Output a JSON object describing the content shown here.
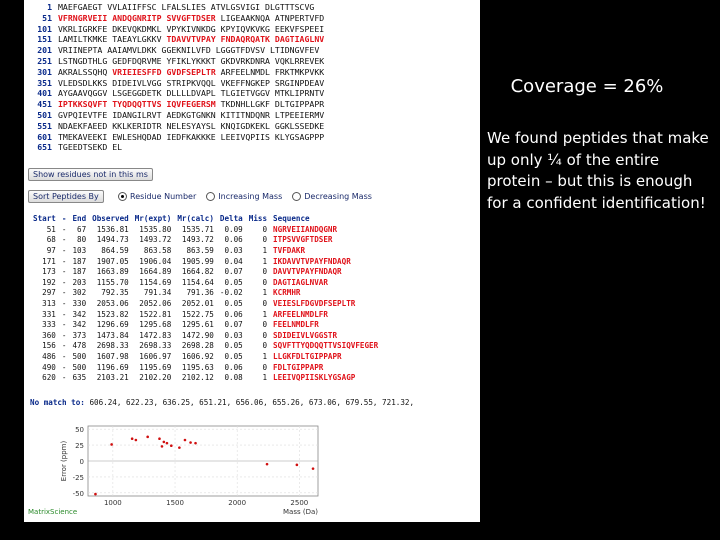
{
  "seq_rows": [
    {
      "num": "1",
      "segs": [
        [
          "MAEFGAEGT VVLAIIFFSC LFALSLIES ATVLGSVIGI DLGTTTSCVG",
          false
        ]
      ]
    },
    {
      "num": "51",
      "segs": [
        [
          "VFRNGRVEII ANDQGNRITP SVVGFTDSER",
          true
        ],
        [
          " LIGEAAKNQA ATNPERTVFD",
          false
        ]
      ]
    },
    {
      "num": "101",
      "segs": [
        [
          "VKRLIGRKFE DKEVQKDMKL VPYKIVNKDG KPYIQVKVKG EEKVFSPEEI",
          false
        ]
      ]
    },
    {
      "num": "151",
      "segs": [
        [
          "LAMILTKMKE TAEAYLGKKV ",
          false
        ],
        [
          "TDAVVTVPAY FNDAQRQATK DAGTIAGLNV",
          true
        ]
      ]
    },
    {
      "num": "201",
      "segs": [
        [
          "VRIINEPTA AAIAMVLDKK GGEKNILVFD LGGGTFDVSV LTIDNGVFEV",
          false
        ]
      ]
    },
    {
      "num": "251",
      "segs": [
        [
          "LSTNGDTHLG GEDFDQRVME YFIKLYKKKT GKDVRKDNRA VQKLRREVEK",
          false
        ]
      ]
    },
    {
      "num": "301",
      "segs": [
        [
          "AKRALSSQHQ ",
          false
        ],
        [
          "VRIEIESFFD GVDFSEPLTR",
          true
        ],
        [
          " ARFEELNMDL FRKTMKPVKK",
          false
        ]
      ]
    },
    {
      "num": "351",
      "segs": [
        [
          "VLEDSDLKKS DIDEIVLVGG STRIPKVQQL VKEFFNGKEP SRGINPDEAV",
          false
        ]
      ]
    },
    {
      "num": "401",
      "segs": [
        [
          "AYGAAVQGGV LSGEGGDETK DLLLLDVAPL TLGIETVGGV MTKLIPRNTV",
          false
        ]
      ]
    },
    {
      "num": "451",
      "segs": [
        [
          "IPTKKSQVFT TYQDQQTTVS IQVFEGERSM",
          true
        ],
        [
          " TKDNHLLGKF DLTGIPPAPR",
          false
        ]
      ]
    },
    {
      "num": "501",
      "segs": [
        [
          "GVPQIEVTFE IDANGILRVT AEDKGTGNKN KITITNDQNR LTPEEIERMV",
          false
        ]
      ]
    },
    {
      "num": "551",
      "segs": [
        [
          "NDAEKFAEED KKLKERIDTR NELESYAYSL KNQIGDKEKL GGKLSSEDKE",
          false
        ]
      ]
    },
    {
      "num": "601",
      "segs": [
        [
          "TMEKAVEEKI EWLESHQDAD IEDFKAKKKE LEEIVQPIIS KLYGSAGPPP",
          false
        ]
      ]
    },
    {
      "num": "651",
      "segs": [
        [
          "TGEEDTSEKD EL",
          false
        ]
      ]
    }
  ],
  "controls": {
    "show_residues_label": "Show residues not in this ms",
    "sort_peptides_label": "Sort Peptides By",
    "sort_options": [
      "Residue Number",
      "Increasing Mass",
      "Decreasing Mass"
    ],
    "sort_selected": 0
  },
  "table": {
    "headers": [
      "Start",
      "-",
      "End",
      "Observed",
      "Mr(expt)",
      "Mr(calc)",
      "Delta",
      "Miss",
      "Sequence"
    ],
    "rows": [
      [
        "51",
        "-",
        "67",
        "1536.81",
        "1535.80",
        "1535.71",
        "0.09",
        "0",
        "NGRVEIIANDQGNR"
      ],
      [
        "68",
        "-",
        "80",
        "1494.73",
        "1493.72",
        "1493.72",
        "0.06",
        "0",
        "ITPSVVGFTDSER"
      ],
      [
        "97",
        "-",
        "103",
        "864.59",
        "863.58",
        "863.59",
        "0.03",
        "1",
        "TVFDAKR"
      ],
      [
        "171",
        "-",
        "187",
        "1907.05",
        "1906.04",
        "1905.99",
        "0.04",
        "1",
        "IKDAVVTVPAYFNDAQR"
      ],
      [
        "173",
        "-",
        "187",
        "1663.89",
        "1664.89",
        "1664.82",
        "0.07",
        "0",
        "DAVVTVPAYFNDAQR"
      ],
      [
        "192",
        "-",
        "203",
        "1155.70",
        "1154.69",
        "1154.64",
        "0.05",
        "0",
        "DAGTIAGLNVAR"
      ],
      [
        "297",
        "-",
        "302",
        "792.35",
        "791.34",
        "791.36",
        "-0.02",
        "1",
        "KCRMHR"
      ],
      [
        "313",
        "-",
        "330",
        "2053.06",
        "2052.06",
        "2052.01",
        "0.05",
        "0",
        "VEIESLFDGVDFSEPLTR"
      ],
      [
        "331",
        "-",
        "342",
        "1523.82",
        "1522.81",
        "1522.75",
        "0.06",
        "1",
        "ARFEELNMDLFR"
      ],
      [
        "333",
        "-",
        "342",
        "1296.69",
        "1295.68",
        "1295.61",
        "0.07",
        "0",
        "FEELNMDLFR"
      ],
      [
        "360",
        "-",
        "373",
        "1473.84",
        "1472.83",
        "1472.90",
        "0.03",
        "0",
        "SDIDEIVLVGGSTR"
      ],
      [
        "156",
        "-",
        "478",
        "2698.33",
        "2698.33",
        "2698.28",
        "0.05",
        "0",
        "SQVFTTYQDQQTTVSIQVFEGER"
      ],
      [
        "486",
        "-",
        "500",
        "1607.98",
        "1606.97",
        "1606.92",
        "0.05",
        "1",
        "LLGKFDLTGIPPAPR"
      ],
      [
        "490",
        "-",
        "500",
        "1196.69",
        "1195.69",
        "1195.63",
        "0.06",
        "0",
        "FDLTGIPPAPR"
      ],
      [
        "620",
        "-",
        "635",
        "2103.21",
        "2102.20",
        "2102.12",
        "0.08",
        "1",
        "LEEIVQPIISKLYGSAGP"
      ]
    ]
  },
  "no_match": {
    "label": "No match to:",
    "values": "606.24, 622.23, 636.25, 651.21, 656.06, 655.26, 673.06, 679.55, 721.32,"
  },
  "error_plot": {
    "ylabel": "Error (ppm)",
    "xlabel": "Mass (Da)",
    "y_ticks": [
      "50",
      "25",
      "0",
      "-25",
      "-50"
    ],
    "x_ticks": [
      "1000",
      "1500",
      "2000",
      "2500"
    ],
    "xlim": [
      800,
      2650
    ],
    "ylim": [
      -55,
      55
    ],
    "points": [
      [
        860,
        -52
      ],
      [
        990,
        26
      ],
      [
        1155,
        35
      ],
      [
        1185,
        33
      ],
      [
        1280,
        38
      ],
      [
        1375,
        35
      ],
      [
        1395,
        23
      ],
      [
        1410,
        30
      ],
      [
        1435,
        28
      ],
      [
        1470,
        24
      ],
      [
        1535,
        21
      ],
      [
        1580,
        33
      ],
      [
        1625,
        29
      ],
      [
        1665,
        28
      ],
      [
        2240,
        -5
      ],
      [
        2480,
        -6
      ],
      [
        2610,
        -12
      ]
    ],
    "footer": "MatrixScience"
  },
  "slide": {
    "title": "Coverage = 26%",
    "body": "We found peptides that make up only ¼ of the entire protein – but this is enough for a confident identification!"
  }
}
